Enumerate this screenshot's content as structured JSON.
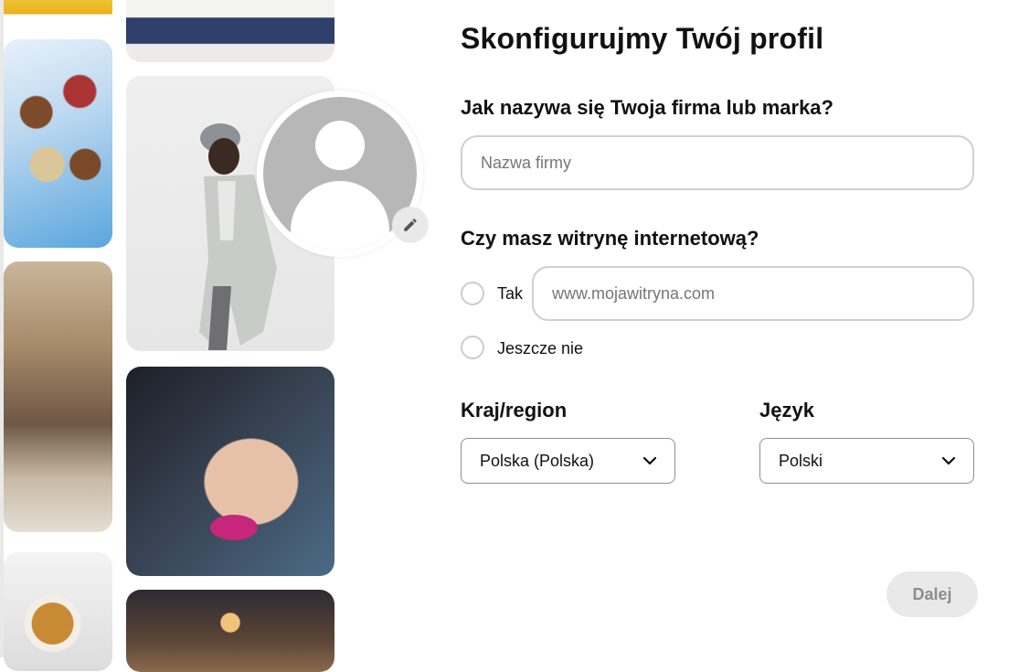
{
  "form": {
    "title": "Skonfigurujmy Twój profil",
    "business_name_question": "Jak nazywa się Twoja firma lub marka?",
    "business_name_placeholder": "Nazwa firmy",
    "business_name_value": "",
    "website_question": "Czy masz witrynę internetową?",
    "website_yes_label": "Tak",
    "website_placeholder": "www.mojawitryna.com",
    "website_no_label": "Jeszcze nie",
    "country_label": "Kraj/region",
    "country_selected": "Polska (Polska)",
    "language_label": "Język",
    "language_selected": "Polski",
    "next_label": "Dalej"
  },
  "icons": {
    "edit": "pencil-icon",
    "dropdown": "chevron-down-icon",
    "avatar": "default-avatar-icon"
  },
  "colors": {
    "input_border": "#cfcfcf",
    "avatar_gray": "#b7b7b7",
    "disabled_button_bg": "#e9e9e9",
    "disabled_button_text": "#8d8d8d"
  }
}
